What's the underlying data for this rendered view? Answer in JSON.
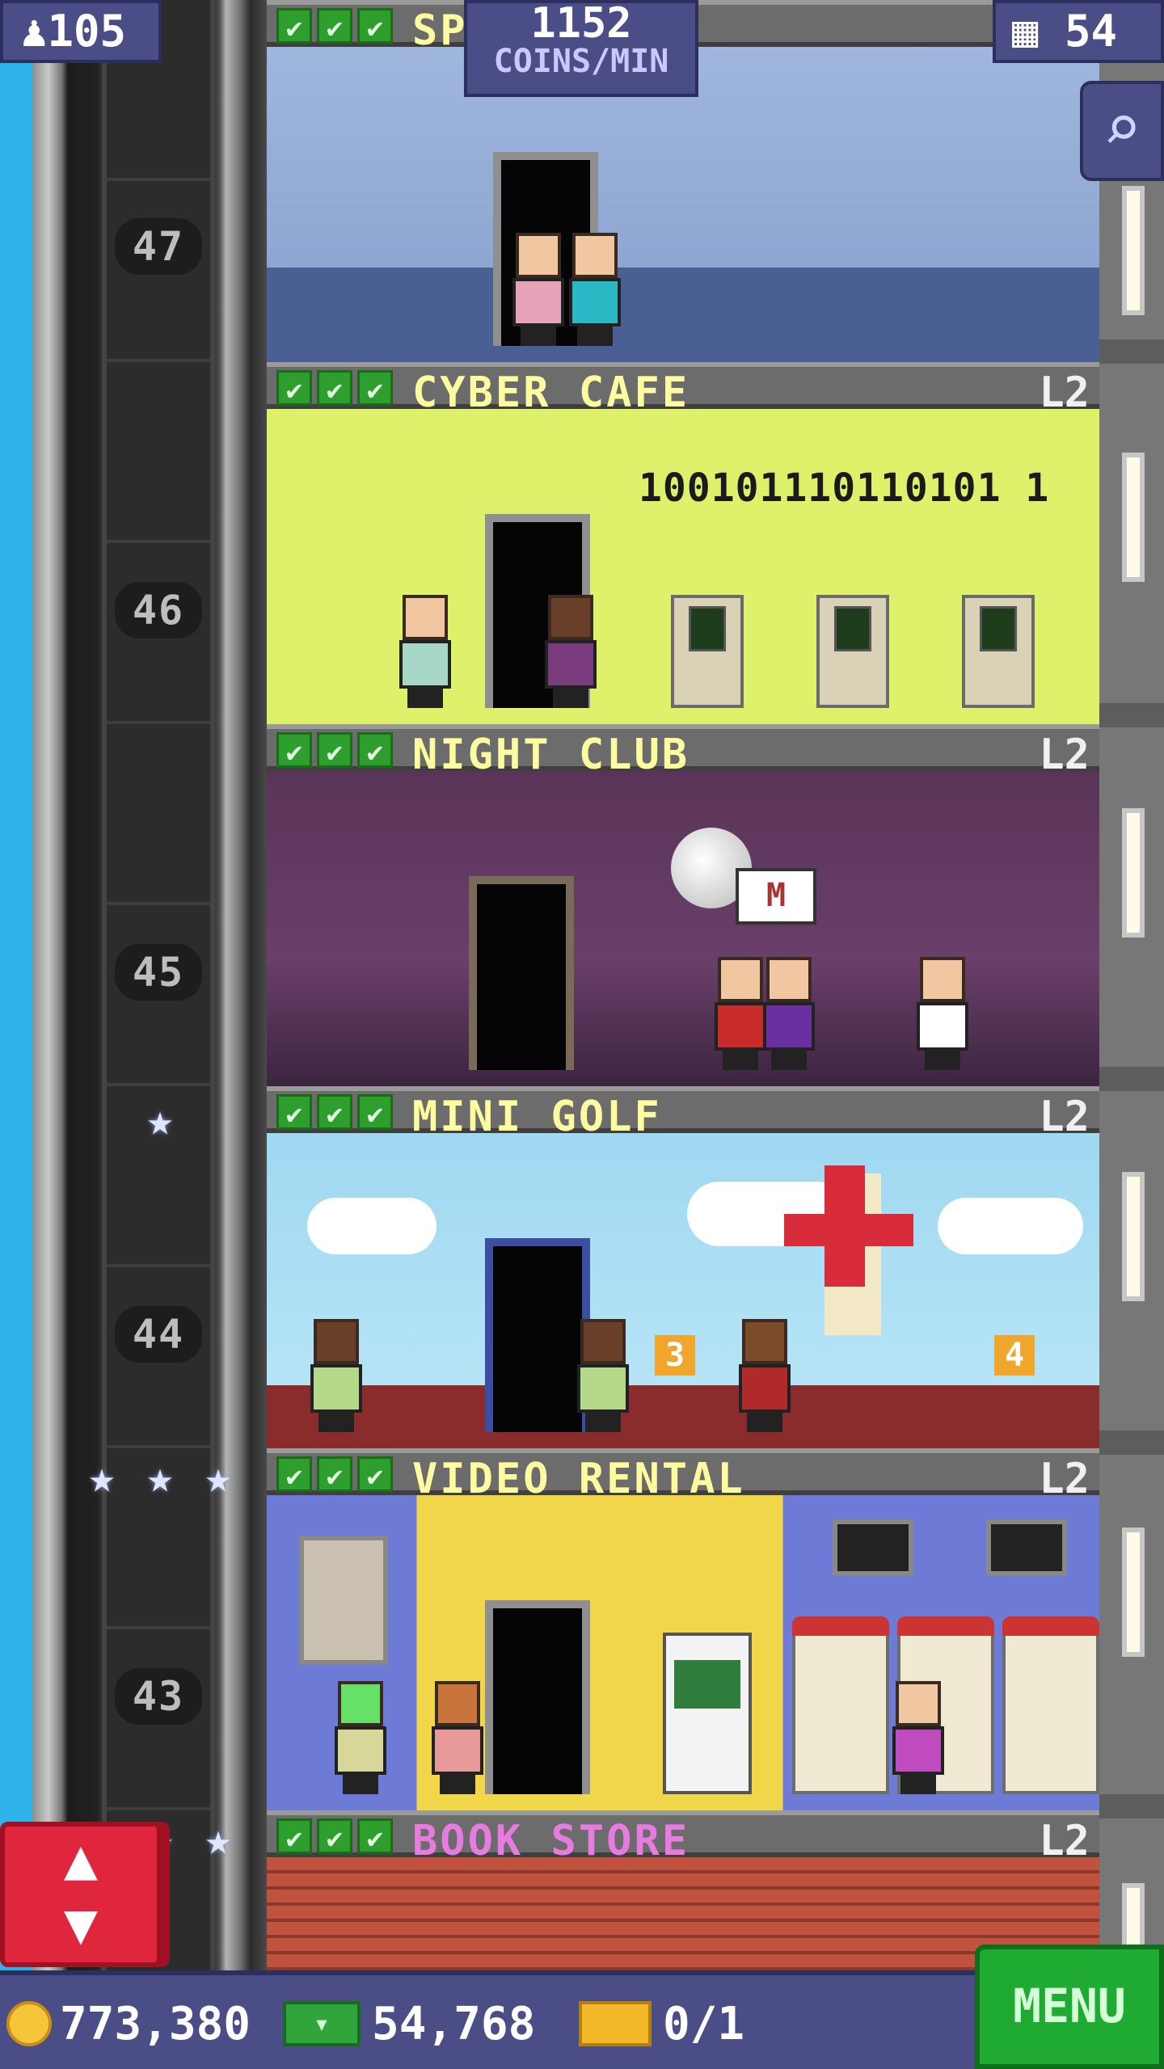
{
  "hud": {
    "population": "105",
    "coins_per_min_value": "1152",
    "coins_per_min_unit": "COINS/MIN",
    "floors_count": "54"
  },
  "shaft": {
    "floor_numbers": [
      "47",
      "46",
      "45",
      "44",
      "43"
    ]
  },
  "floors": [
    {
      "name": "SPA ZONE",
      "level": "",
      "checks": [
        "✔",
        "✔",
        "✔"
      ]
    },
    {
      "name": "CYBER CAFE",
      "level": "L2",
      "checks": [
        "✔",
        "✔",
        "✔"
      ],
      "sign": "100101110110101 1"
    },
    {
      "name": "NIGHT CLUB",
      "level": "L2",
      "checks": [
        "✔",
        "✔",
        "✔"
      ],
      "speech": "M"
    },
    {
      "name": "MINI GOLF",
      "level": "L2",
      "checks": [
        "✔",
        "✔",
        "✔"
      ],
      "hole_flags": [
        "3",
        "4"
      ]
    },
    {
      "name": "VIDEO RENTAL",
      "level": "L2",
      "checks": [
        "✔",
        "✔",
        "✔"
      ]
    },
    {
      "name": "BOOK STORE",
      "level": "L2",
      "checks": [
        "✔",
        "✔",
        "✔"
      ]
    }
  ],
  "bottom_bar": {
    "coins": "773,380",
    "bux": "54,768",
    "tickets": "0/1",
    "menu_label": "MENU"
  },
  "icons": {
    "population": "person-icon",
    "floors": "building-icon",
    "zoom": "magnifier-icon",
    "elevator": "up-down-arrow-icon"
  },
  "colors": {
    "hud_bg": "#4a4d86",
    "menu_green": "#1faa32",
    "elevator_red": "#e0263c",
    "check_green": "#2e9f2e"
  }
}
